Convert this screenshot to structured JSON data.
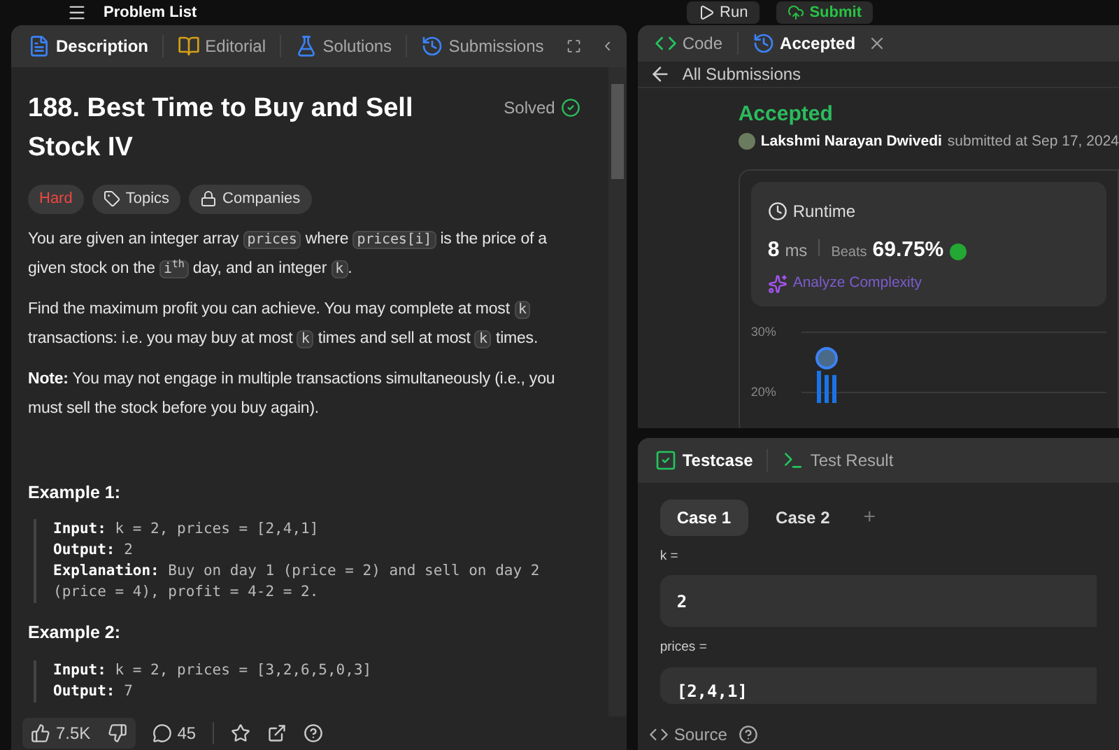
{
  "topbar": {
    "title": "Problem List",
    "run": "Run",
    "submit": "Submit"
  },
  "left_tabs": [
    {
      "label": "Description",
      "selected": true,
      "kind": "description"
    },
    {
      "label": "Editorial",
      "selected": false,
      "kind": "editorial"
    },
    {
      "label": "Solutions",
      "selected": false,
      "kind": "solutions"
    },
    {
      "label": "Submissions",
      "selected": false,
      "kind": "submissions"
    }
  ],
  "problem": {
    "title": "188. Best Time to Buy and Sell Stock IV",
    "status": "Solved",
    "tags": [
      {
        "label": "Hard",
        "kind": "difficulty"
      },
      {
        "label": "Topics",
        "kind": "topics"
      },
      {
        "label": "Companies",
        "kind": "companies"
      }
    ],
    "paragraphs": [
      [
        {
          "kind": "text",
          "text": "You are given an integer array "
        },
        {
          "kind": "code",
          "text": "prices"
        },
        {
          "kind": "text",
          "text": " where "
        },
        {
          "kind": "code",
          "text": "prices[i]"
        },
        {
          "kind": "text",
          "text": " is the price of a given stock on the "
        },
        {
          "kind": "code",
          "text": "i$^{th}$"
        },
        {
          "kind": "text",
          "text": " day, and an integer "
        },
        {
          "kind": "code",
          "text": "k"
        },
        {
          "kind": "text",
          "text": "."
        }
      ],
      [
        {
          "kind": "text",
          "text": "Find the maximum profit you can achieve. You may complete at most "
        },
        {
          "kind": "code",
          "text": "k"
        },
        {
          "kind": "text",
          "text": " transactions: i.e. you may buy at most "
        },
        {
          "kind": "code",
          "text": "k"
        },
        {
          "kind": "text",
          "text": " times and sell at most "
        },
        {
          "kind": "code",
          "text": "k"
        },
        {
          "kind": "text",
          "text": " times."
        }
      ],
      [
        {
          "kind": "bold",
          "text": "Note:"
        },
        {
          "kind": "text",
          "text": " You may not engage in multiple transactions simultaneously (i.e., you must sell the stock before you buy again)."
        }
      ]
    ],
    "examples": [
      {
        "title": "Example 1:",
        "lines": [
          "**Input:** k = 2, prices = [2,4,1]",
          "**Output:** 2",
          "**Explanation:** Buy on day 1 (price = 2) and sell on day 2 (price = 4), profit = 4-2 = 2."
        ]
      },
      {
        "title": "Example 2:",
        "lines": [
          "**Input:** k = 2, prices = [3,2,6,5,0,3]",
          "**Output:** 7"
        ]
      }
    ]
  },
  "footer": {
    "likes": "7.5K",
    "comments": "45"
  },
  "right_tabs": [
    {
      "label": "Code",
      "selected": false,
      "kind": "code",
      "closable": false
    },
    {
      "label": "Accepted",
      "selected": true,
      "kind": "history",
      "closable": true
    }
  ],
  "back_link": "All Submissions",
  "submission": {
    "status": "Accepted",
    "author": "Lakshmi Narayan Dwivedi",
    "submitted": "submitted at Sep 17, 2024",
    "runtime_label": "Runtime",
    "runtime_value": "8",
    "runtime_unit": "ms",
    "beats_label": "Beats",
    "beats_value": "69.75%",
    "analyze": "Analyze Complexity",
    "chart_ticks": [
      "30%",
      "20%"
    ]
  },
  "test_tabs": [
    {
      "label": "Testcase",
      "selected": true,
      "kind": "testcase"
    },
    {
      "label": "Test Result",
      "selected": false,
      "kind": "result"
    }
  ],
  "cases": [
    {
      "label": "Case 1",
      "selected": true
    },
    {
      "label": "Case 2",
      "selected": false
    }
  ],
  "add_case": "+",
  "inputs": [
    {
      "label": "k =",
      "value": "2"
    },
    {
      "label": "prices =",
      "value": "[2,4,1]"
    }
  ],
  "source": "Source"
}
